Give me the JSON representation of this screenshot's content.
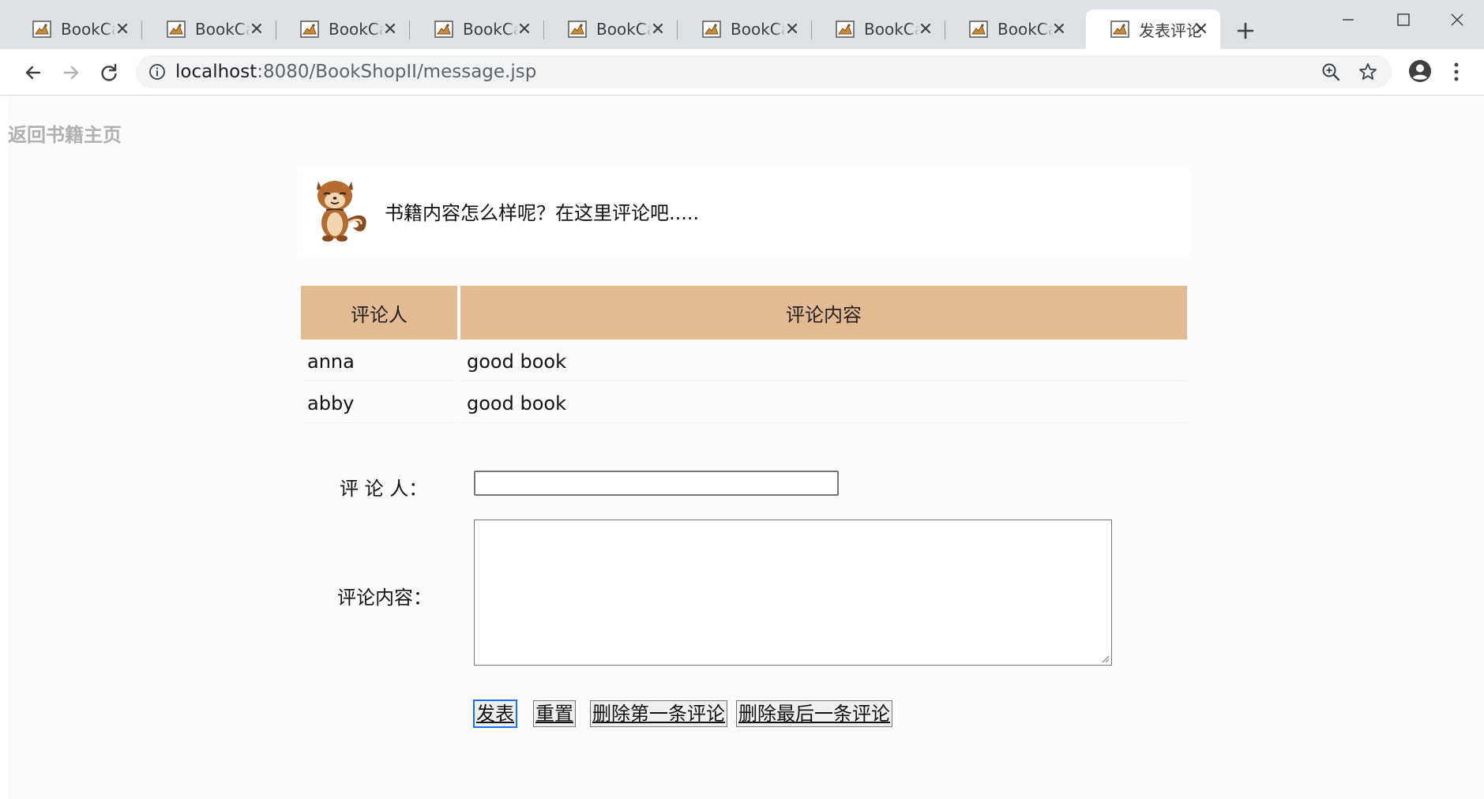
{
  "browser": {
    "tabs": [
      {
        "title": "BookCar",
        "icon": "bookcar-favicon-icon"
      },
      {
        "title": "BookCar",
        "icon": "bookcar-favicon-icon"
      },
      {
        "title": "BookCar",
        "icon": "bookcar-favicon-icon"
      },
      {
        "title": "BookCar",
        "icon": "bookcar-favicon-icon"
      },
      {
        "title": "BookCar",
        "icon": "bookcar-favicon-icon"
      },
      {
        "title": "BookCar",
        "icon": "bookcar-favicon-icon"
      },
      {
        "title": "BookCar",
        "icon": "bookcar-favicon-icon"
      },
      {
        "title": "BookCar",
        "icon": "bookcar-favicon-icon"
      },
      {
        "title": "发表评论",
        "icon": "bookcar-favicon-icon",
        "active": true
      }
    ],
    "url_host": "localhost",
    "url_path": ":8080/BookShopII/message.jsp"
  },
  "page": {
    "back_link": "返回书籍主页",
    "header_prompt": "书籍内容怎么样呢？在这里评论吧.....",
    "table": {
      "headers": [
        "评论人",
        "评论内容"
      ],
      "rows": [
        {
          "author": "anna",
          "content": "good book"
        },
        {
          "author": "abby",
          "content": "good book"
        }
      ]
    },
    "form": {
      "name_label": "评 论 人：",
      "name_value": "",
      "content_label": "评论内容：",
      "content_value": "",
      "buttons": {
        "submit": "发表",
        "reset": "重置",
        "delete_first": "删除第一条评论",
        "delete_last": "删除最后一条评论"
      }
    }
  },
  "colors": {
    "table_header_bg": "#e4ba93",
    "back_link": "#b0b0b0",
    "tabstrip_bg": "#dee1e6"
  }
}
